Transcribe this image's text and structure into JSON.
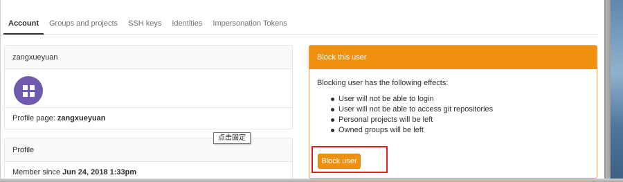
{
  "tabs": [
    {
      "label": "Account",
      "active": true
    },
    {
      "label": "Groups and projects",
      "active": false
    },
    {
      "label": "SSH keys",
      "active": false
    },
    {
      "label": "Identities",
      "active": false
    },
    {
      "label": "Impersonation Tokens",
      "active": false
    }
  ],
  "user_card": {
    "username": "zangxueyuan",
    "profile_page_label": "Profile page:",
    "profile_page_value": "zangxueyuan",
    "avatar_color": "#6f5aae"
  },
  "profile_card": {
    "title": "Profile",
    "member_since_label": "Member since",
    "member_since_value": "Jun 24, 2018 1:33pm"
  },
  "tooltip": {
    "text": "点击固定"
  },
  "block_card": {
    "title": "Block this user",
    "description": "Blocking user has the following effects:",
    "effects": [
      "User will not be able to login",
      "User will not be able to access git repositories",
      "Personal projects will be left",
      "Owned groups will be left"
    ],
    "button_label": "Block user",
    "accent_color": "#f0900f",
    "highlight_color": "#e02020"
  }
}
